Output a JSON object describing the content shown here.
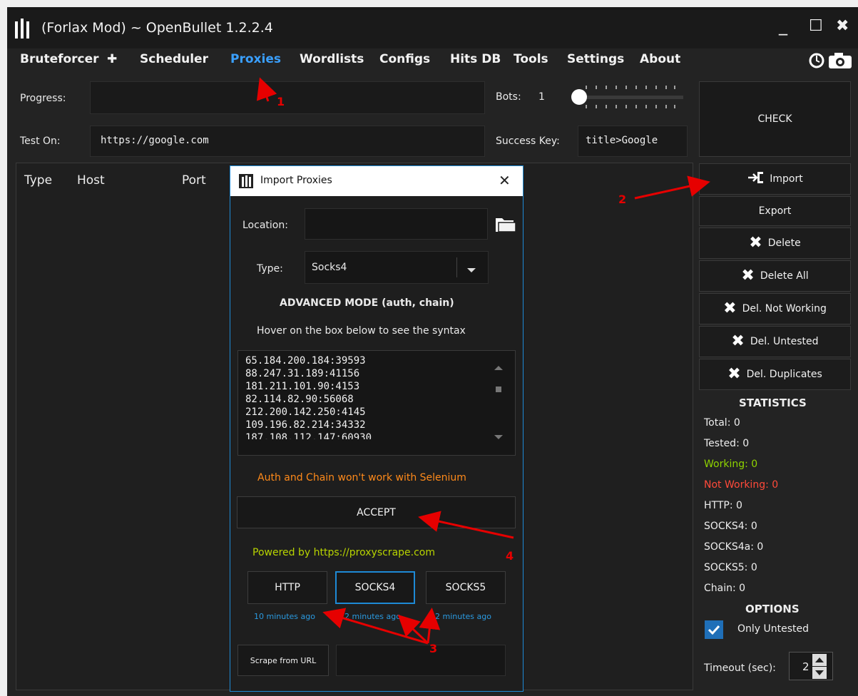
{
  "window": {
    "title": "(Forlax Mod) ~ OpenBullet 1.2.2.4",
    "minimize": "_",
    "maximize": "☐",
    "close": "✖"
  },
  "menu": {
    "items": [
      "Bruteforcer",
      "Scheduler",
      "Proxies",
      "Wordlists",
      "Configs",
      "Hits DB",
      "Tools",
      "Settings",
      "About"
    ],
    "plus": "✚",
    "active": "Proxies",
    "active_color": "#3aa0ff"
  },
  "top_panel": {
    "progress_label": "Progress:",
    "bots_label": "Bots:",
    "bots_value": "1",
    "test_on_label": "Test On:",
    "test_on_value": "https://google.com",
    "success_key_label": "Success Key:",
    "success_key_value": "title>Google",
    "check_button": "CHECK"
  },
  "table": {
    "columns": [
      "Type",
      "Host",
      "Port"
    ]
  },
  "side_buttons": {
    "import": "Import",
    "export": "Export",
    "delete": "Delete",
    "delete_all": "Delete All",
    "del_not_working": "Del. Not Working",
    "del_untested": "Del. Untested",
    "del_duplicates": "Del. Duplicates"
  },
  "statistics": {
    "title": "STATISTICS",
    "total": "Total:  0",
    "tested": "Tested:  0",
    "working": "Working:  0",
    "not_working": "Not Working:  0",
    "http": "HTTP:  0",
    "socks4": "SOCKS4:  0",
    "socks4a": "SOCKS4a:  0",
    "socks5": "SOCKS5:  0",
    "chain": "Chain:  0",
    "working_color": "#8fd400",
    "not_working_color": "#ff4a3a"
  },
  "options": {
    "title": "OPTIONS",
    "only_untested": "Only Untested",
    "only_untested_checked": true,
    "timeout_label": "Timeout (sec):",
    "timeout_value": "2"
  },
  "dialog": {
    "title": "Import Proxies",
    "close": "✕",
    "location_label": "Location:",
    "location_value": "",
    "type_label": "Type:",
    "type_value": "Socks4",
    "advanced": "ADVANCED MODE (auth, chain)",
    "hover_hint": "Hover on the box below to see the syntax",
    "proxies": [
      "65.184.200.184:39593",
      "88.247.31.189:41156",
      "181.211.101.90:4153",
      "82.114.82.90:56068",
      "212.200.142.250:4145",
      "109.196.82.214:34332",
      "187.108.112.147:60930"
    ],
    "warning": "Auth and Chain won't work with Selenium",
    "warning_color": "#ff8a1a",
    "accept": "ACCEPT",
    "powered_by": "Powered by  https://proxyscrape.com",
    "powered_color": "#b8d400",
    "source_buttons": [
      "HTTP",
      "SOCKS4",
      "SOCKS5"
    ],
    "times": [
      "10 minutes ago",
      "2 minutes ago",
      "2 minutes ago"
    ],
    "time_color": "#2a9ae0",
    "scrape_button": "Scrape from URL",
    "scrape_url": ""
  },
  "annotations": {
    "n1": "1",
    "n2": "2",
    "n3": "3",
    "n4": "4",
    "color": "#e60000"
  }
}
